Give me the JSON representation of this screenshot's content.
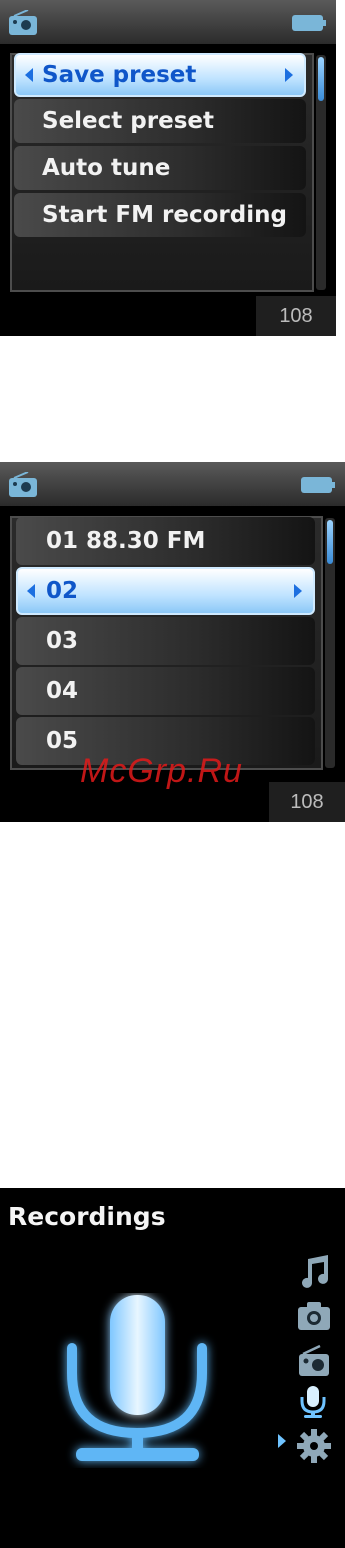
{
  "screen1": {
    "menu_items": [
      {
        "label": "Save preset",
        "selected": true
      },
      {
        "label": "Select preset",
        "selected": false
      },
      {
        "label": "Auto tune",
        "selected": false
      },
      {
        "label": "Start FM recording",
        "selected": false
      }
    ],
    "counter": "108"
  },
  "screen2": {
    "presets": [
      {
        "label": "01  88.30 FM",
        "selected": false
      },
      {
        "label": "02",
        "selected": true
      },
      {
        "label": "03",
        "selected": false
      },
      {
        "label": "04",
        "selected": false
      },
      {
        "label": "05",
        "selected": false
      }
    ],
    "counter": "108"
  },
  "watermark": "McGrp.Ru",
  "screen3": {
    "title": "Recordings",
    "nav_icons": [
      "music-note-icon",
      "camera-icon",
      "radio-icon",
      "microphone-icon",
      "gear-icon"
    ],
    "active_nav": "microphone-icon"
  },
  "colors": {
    "accent_blue": "#1c6fe0",
    "glow_blue": "#6fc3ff"
  }
}
